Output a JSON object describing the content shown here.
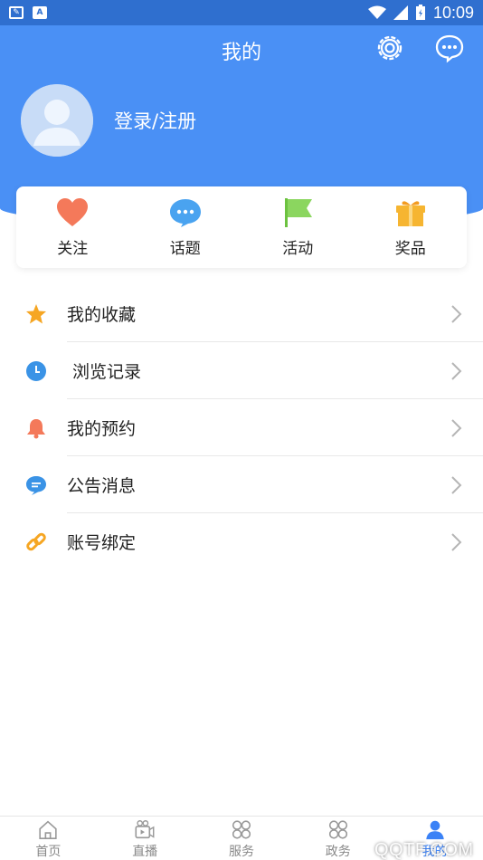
{
  "status_bar": {
    "time": "10:09"
  },
  "header": {
    "title": "我的",
    "login_text": "登录/注册"
  },
  "quick_actions": [
    {
      "label": "关注",
      "icon": "heart-icon",
      "color": "#f4795a"
    },
    {
      "label": "话题",
      "icon": "chat-bubble-icon",
      "color": "#4aa3f0"
    },
    {
      "label": "活动",
      "icon": "flag-icon",
      "color": "#7bd14f"
    },
    {
      "label": "奖品",
      "icon": "gift-icon",
      "color": "#f6b531"
    }
  ],
  "menu": [
    {
      "label": "我的收藏",
      "icon": "star-icon",
      "color": "#f6a623"
    },
    {
      "label": "浏览记录",
      "icon": "clock-icon",
      "color": "#3a93e6"
    },
    {
      "label": "我的预约",
      "icon": "bell-icon",
      "color": "#f4795a"
    },
    {
      "label": "公告消息",
      "icon": "message-icon",
      "color": "#3a93e6"
    },
    {
      "label": "账号绑定",
      "icon": "link-icon",
      "color": "#f6a623"
    }
  ],
  "tabs": [
    {
      "label": "首页",
      "icon": "home-icon",
      "active": false
    },
    {
      "label": "直播",
      "icon": "live-icon",
      "active": false
    },
    {
      "label": "服务",
      "icon": "grid-icon",
      "active": false
    },
    {
      "label": "政务",
      "icon": "grid-icon",
      "active": false
    },
    {
      "label": "我的",
      "icon": "user-icon",
      "active": true
    }
  ],
  "watermark": "QQTF.COM",
  "colors": {
    "primary": "#4a90f5",
    "status_bar": "#2f6fcf",
    "active_tab": "#3b82f6"
  }
}
